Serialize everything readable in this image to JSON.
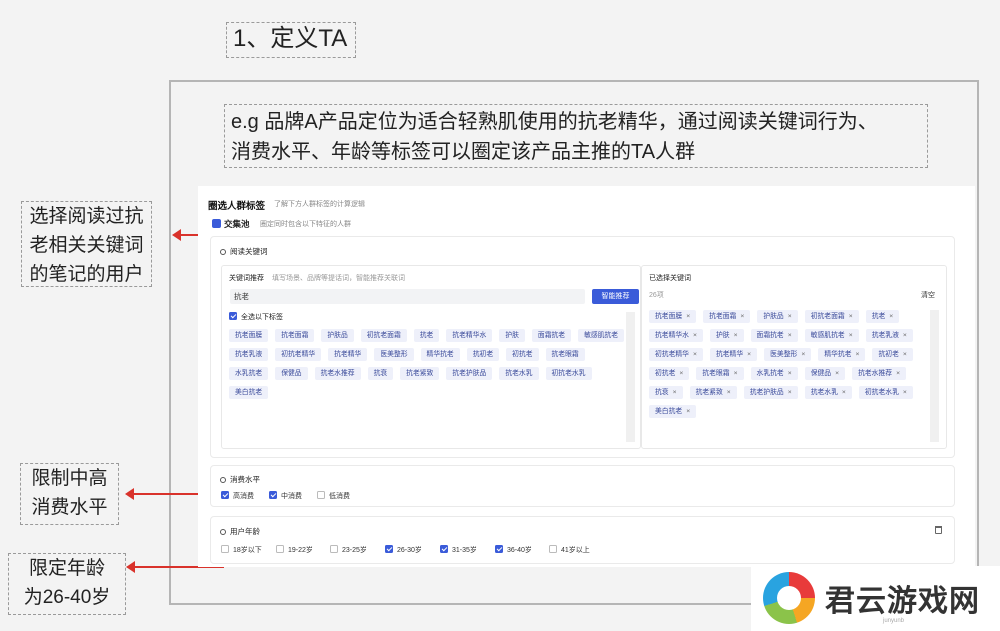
{
  "title": "1、定义TA",
  "note": [
    "e.g 品牌A产品定位为适合轻熟肌使用的抗老精华，通过阅读关键词行为、",
    "消费水平、年龄等标签可以圈定该产品主推的TA人群"
  ],
  "side_notes": [
    [
      "选择阅读过抗",
      "老相关关键词",
      "的笔记的用户"
    ],
    [
      "限制中高",
      "消费水平"
    ],
    [
      "限定年龄",
      "为26-40岁"
    ]
  ],
  "panel": {
    "header": "圈选人群标签",
    "header_hint": "了解下方人群标签的计算逻辑",
    "pool_label": "交集池",
    "pool_hint": "圈定同时包含以下特征的人群",
    "keyword_section": {
      "title": "阅读关键词",
      "recommend_label": "关键词推荐",
      "recommend_hint": "填写场景、品牌等提话词，智能推荐关联词",
      "search_value": "抗老",
      "button": "智能推荐",
      "select_all": "全选以下标签",
      "tags": [
        "抗老面膜",
        "抗老面霜",
        "护肤品",
        "初抗老面霜",
        "抗老",
        "抗老精华水",
        "护肤",
        "面霜抗老",
        "敏感肌抗老",
        "抗老乳液",
        "初抗老精华",
        "抗老精华",
        "医美整形",
        "精华抗老",
        "抗初老",
        "初抗老",
        "抗老眼霜",
        "水乳抗老",
        "保健品",
        "抗老水推荐",
        "抗衰",
        "抗老紧致",
        "抗老护肤品",
        "抗老水乳",
        "初抗老水乳",
        "美白抗老"
      ],
      "selected_label": "已选择关键词",
      "selected_count": "26项",
      "clear": "清空",
      "selected": [
        "抗老面膜",
        "抗老面霜",
        "护肤品",
        "初抗老面霜",
        "抗老",
        "抗老精华水",
        "护肤",
        "面霜抗老",
        "敏感肌抗老",
        "抗老乳液",
        "初抗老精华",
        "抗老精华",
        "医美整形",
        "精华抗老",
        "抗初老",
        "初抗老",
        "抗老眼霜",
        "水乳抗老",
        "保健品",
        "抗老水推荐",
        "抗衰",
        "抗老紧致",
        "抗老护肤品",
        "抗老水乳",
        "初抗老水乳",
        "美白抗老"
      ]
    },
    "consumption": {
      "title": "消费水平",
      "options": [
        {
          "label": "高消费",
          "checked": true
        },
        {
          "label": "中消费",
          "checked": true
        },
        {
          "label": "低消费",
          "checked": false
        }
      ]
    },
    "age": {
      "title": "用户年龄",
      "options": [
        {
          "label": "18岁以下",
          "checked": false
        },
        {
          "label": "19-22岁",
          "checked": false
        },
        {
          "label": "23-25岁",
          "checked": false
        },
        {
          "label": "26-30岁",
          "checked": true
        },
        {
          "label": "31-35岁",
          "checked": true
        },
        {
          "label": "36-40岁",
          "checked": true
        },
        {
          "label": "41岁以上",
          "checked": false
        }
      ]
    }
  },
  "watermark": {
    "name": "君云游戏网",
    "sub": "junyunb"
  }
}
